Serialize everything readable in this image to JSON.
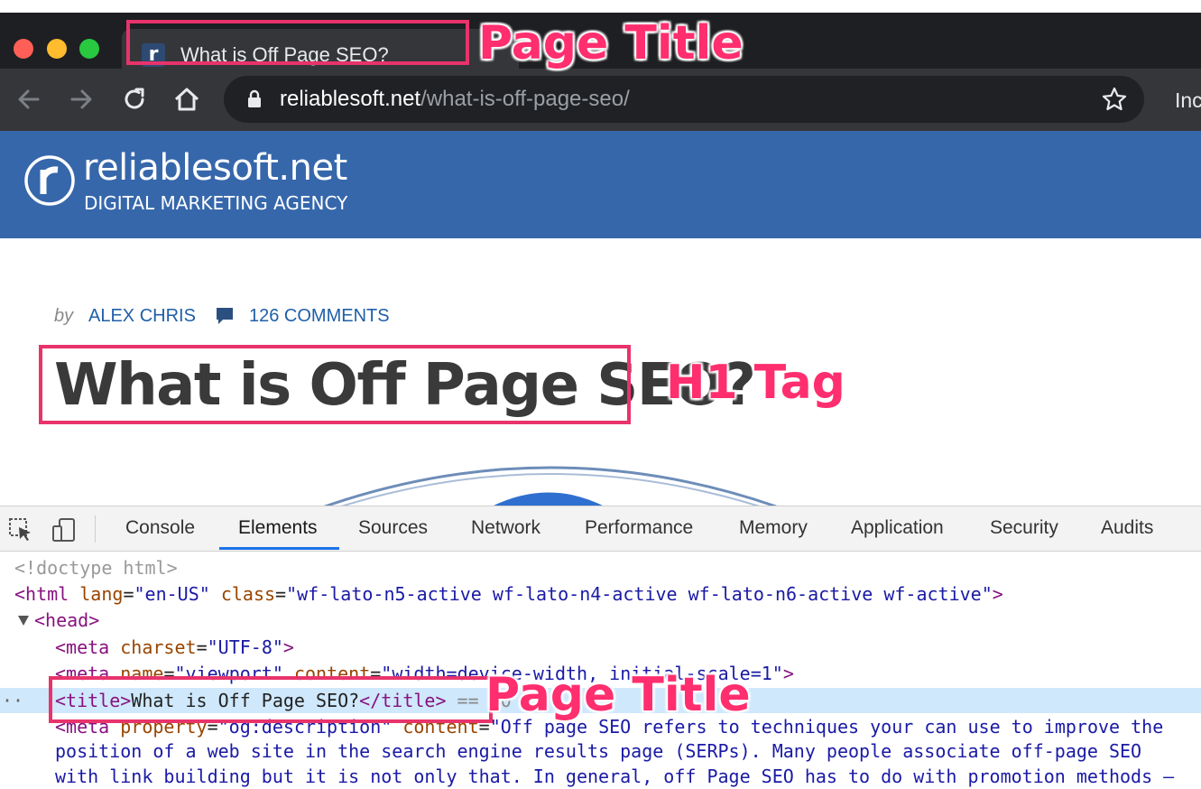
{
  "browser": {
    "tab_title": "What is Off Page SEO?",
    "favicon_letter": "r",
    "url_domain": "reliablesoft.net",
    "url_path": "/what-is-off-page-seo/",
    "profile_label": "Inc"
  },
  "site": {
    "logo_name": "reliablesoft.net",
    "logo_tagline": "DIGITAL MARKETING AGENCY",
    "brand_color": "#3667ab"
  },
  "article": {
    "by_label": "by",
    "author": "ALEX CHRIS",
    "comments": "126 COMMENTS",
    "h1": "What is Off Page SEO?"
  },
  "devtools": {
    "tabs": [
      "Console",
      "Elements",
      "Sources",
      "Network",
      "Performance",
      "Memory",
      "Application",
      "Security",
      "Audits"
    ],
    "active_tab": "Elements",
    "code": {
      "doctype": "<!doctype html>",
      "html_open": "<html",
      "html_lang_attr": "lang",
      "html_lang_val": "\"en-US\"",
      "html_class_attr": "class",
      "html_class_val": "\"wf-lato-n5-active wf-lato-n4-active wf-lato-n6-active wf-active\"",
      "html_close": ">",
      "head_open": "<head>",
      "meta_charset_open": "<meta",
      "meta_charset_attr": "charset",
      "meta_charset_val": "\"UTF-8\"",
      "meta_charset_close": ">",
      "meta_viewport_open": "<meta",
      "meta_viewport_name_attr": "name",
      "meta_viewport_name_val": "\"viewport\"",
      "meta_viewport_content_attr": "content",
      "meta_viewport_content_val": "\"width=device-width, initial-scale=1\"",
      "meta_viewport_close": ">",
      "title_open": "<title>",
      "title_text": "What is Off Page SEO?",
      "title_close": "</title>",
      "title_eq": "== $0",
      "og_open": "<meta",
      "og_prop_attr": "property",
      "og_prop_val": "\"og:description\"",
      "og_content_attr": "content",
      "og_content_line1": "\"Off page SEO refers to techniques your can use to improve the",
      "og_content_line2": "position of a web site in the search engine results page (SERPs). Many people associate off-page SEO",
      "og_content_line3": "with link building but it is not only that. In general, off Page SEO has to do with promotion methods –"
    }
  },
  "annotations": {
    "page_title_top": "Page Title",
    "h1_tag": "H1 Tag",
    "page_title_bottom": "Page Title",
    "color": "#e8336b"
  }
}
